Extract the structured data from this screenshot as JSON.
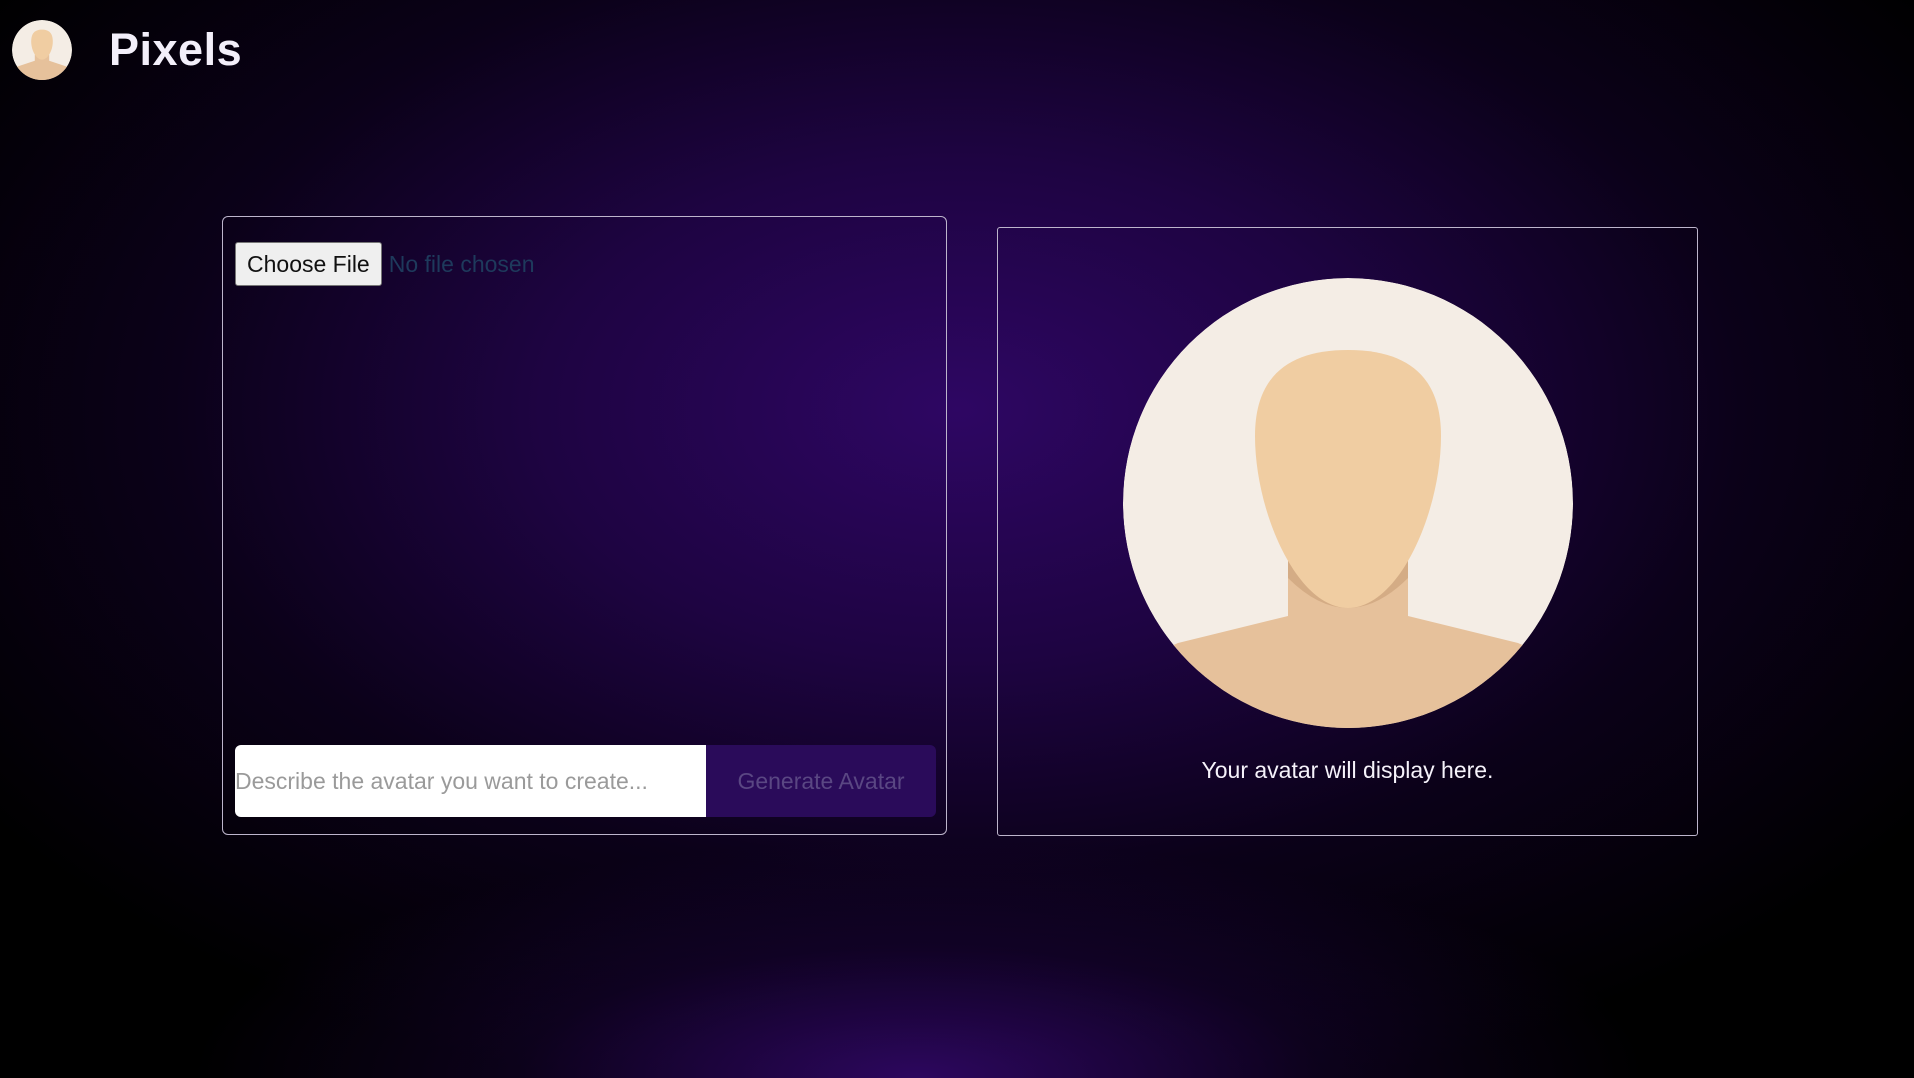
{
  "app": {
    "brand_name": "Pixels",
    "logo_icon": "user-avatar-icon"
  },
  "upload": {
    "choose_file_label": "Choose File",
    "file_status": "No file chosen"
  },
  "prompt": {
    "placeholder": "Describe the avatar you want to create...",
    "value": "",
    "generate_label": "Generate Avatar"
  },
  "preview": {
    "placeholder_icon": "user-silhouette-icon",
    "caption": "Your avatar will display here."
  },
  "colors": {
    "background_center": "#2e0663",
    "background_edge": "#000000",
    "panel_border": "#bdb5cc",
    "generate_button_bg": "#2a0b5a",
    "generate_button_text": "#5a4783",
    "avatar_bg": "#f4ede5",
    "avatar_skin": "#f0cda2",
    "avatar_body": "#e6c19b"
  }
}
